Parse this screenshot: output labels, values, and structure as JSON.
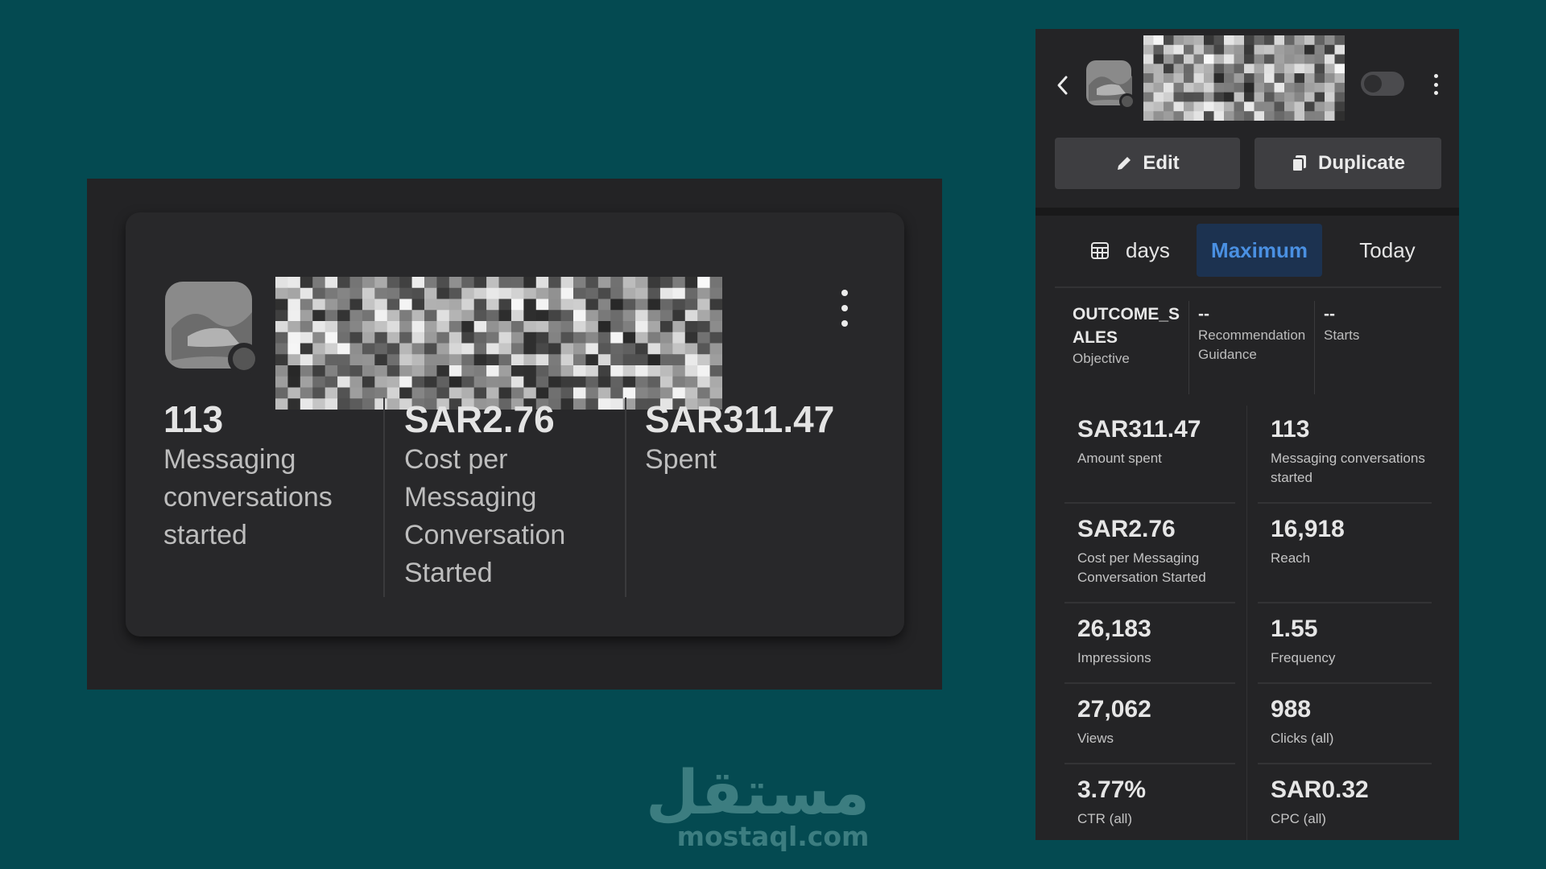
{
  "left_card": {
    "metrics": [
      {
        "value": "113",
        "label": "Messaging conversations started"
      },
      {
        "value": "SAR2.76",
        "label": "Cost per Messaging Conversation Started"
      },
      {
        "value": "SAR311.47",
        "label": "Spent"
      }
    ],
    "menu_icon": "more-vertical-icon"
  },
  "right_panel": {
    "back_icon": "chevron-left-icon",
    "menu_icon": "more-vertical-icon",
    "buttons": {
      "edit_label": "Edit",
      "edit_icon": "pencil-icon",
      "duplicate_label": "Duplicate",
      "duplicate_icon": "copy-icon"
    },
    "date_tabs": {
      "calendar_icon": "calendar-icon",
      "days_label": "days",
      "maximum_label": "Maximum",
      "today_label": "Today",
      "selected": "Maximum"
    },
    "summary": [
      {
        "value": "OUTCOME_SALES",
        "label": "Objective"
      },
      {
        "value": "--",
        "label": "Recommendation Guidance"
      },
      {
        "value": "--",
        "label": "Starts"
      }
    ],
    "stats": [
      {
        "value": "SAR311.47",
        "label": "Amount spent"
      },
      {
        "value": "113",
        "label": "Messaging conversations started"
      },
      {
        "value": "SAR2.76",
        "label": "Cost per Messaging Conversation Started"
      },
      {
        "value": "16,918",
        "label": "Reach"
      },
      {
        "value": "26,183",
        "label": "Impressions"
      },
      {
        "value": "1.55",
        "label": "Frequency"
      },
      {
        "value": "27,062",
        "label": "Views"
      },
      {
        "value": "988",
        "label": "Clicks (all)"
      },
      {
        "value": "3.77%",
        "label": "CTR (all)"
      },
      {
        "value": "SAR0.32",
        "label": "CPC (all)"
      }
    ]
  },
  "watermark": {
    "arabic": "مستقل",
    "domain": "mostaql.com"
  },
  "colors": {
    "background": "#044a51",
    "panel": "#242426",
    "accent": "#4a90e2",
    "selected_tab_bg": "#1c3250"
  }
}
